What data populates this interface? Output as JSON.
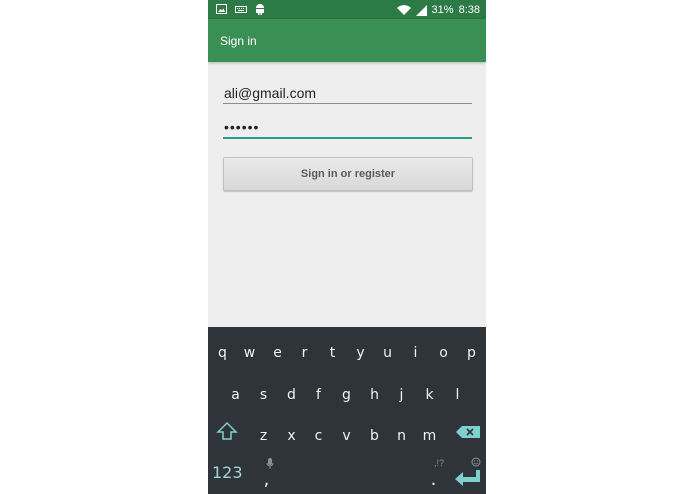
{
  "status_bar": {
    "battery": "31%",
    "time": "8:38",
    "icons": [
      "image-icon",
      "keyboard-icon",
      "android-icon",
      "wifi-icon",
      "signal-icon",
      "battery-icon"
    ]
  },
  "app_bar": {
    "title": "Sign in"
  },
  "form": {
    "email_value": "ali@gmail.com",
    "password_value": "••••••",
    "submit_label": "Sign in or register"
  },
  "keyboard": {
    "row1": [
      "q",
      "w",
      "e",
      "r",
      "t",
      "y",
      "u",
      "i",
      "o",
      "p"
    ],
    "row2": [
      "a",
      "s",
      "d",
      "f",
      "g",
      "h",
      "j",
      "k",
      "l"
    ],
    "row3": [
      "z",
      "x",
      "c",
      "v",
      "b",
      "n",
      "m"
    ],
    "numbers_label": "123",
    "comma_label": ",",
    "period_label": ".",
    "punct_hint": ",!?"
  },
  "colors": {
    "status_bar": "#2c7a45",
    "app_bar": "#3a8f55",
    "accent": "#2a9d8f",
    "keyboard_bg": "#2e3439",
    "key_accent": "#7fd0cc"
  }
}
